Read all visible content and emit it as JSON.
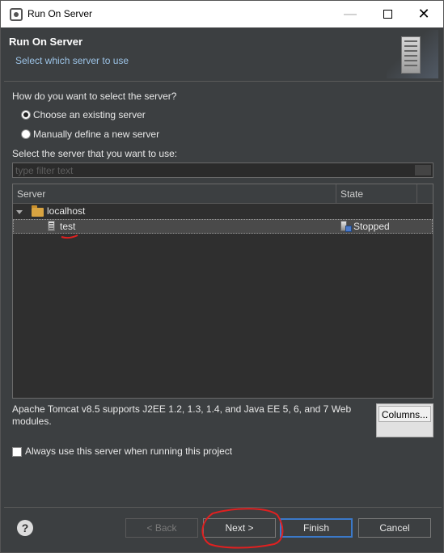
{
  "window": {
    "title": "Run On Server",
    "minimize_glyph": "—",
    "close_glyph": "✕"
  },
  "header": {
    "title": "Run On Server",
    "subtitle": "Select which server to use"
  },
  "form": {
    "question": "How do you want to select the server?",
    "option_existing": "Choose an existing server",
    "option_manual": "Manually define a new server",
    "select_label": "Select the server that you want to use:",
    "filter_placeholder": "type filter text",
    "selected_option": "existing"
  },
  "table": {
    "columns": [
      "Server",
      "State"
    ],
    "host": "localhost",
    "rows": [
      {
        "name": "test",
        "state": "Stopped",
        "selected": true
      }
    ]
  },
  "description": "Apache Tomcat v8.5 supports J2EE 1.2, 1.3, 1.4, and Java EE 5, 6, and 7 Web modules.",
  "columns_button": "Columns...",
  "always_use": "Always use this server when running this project",
  "buttons": {
    "help": "?",
    "back": "< Back",
    "next": "Next >",
    "finish": "Finish",
    "cancel": "Cancel"
  },
  "colors": {
    "background": "#3c3f41",
    "accent": "#3b79c9",
    "subtitle": "#9cc3e6",
    "annotation": "#e02020"
  }
}
